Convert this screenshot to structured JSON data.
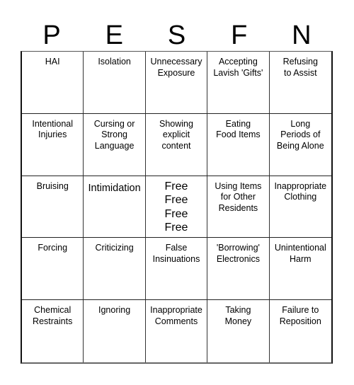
{
  "header": {
    "letters": [
      "P",
      "E",
      "S",
      "F",
      "N"
    ]
  },
  "board": {
    "rows": [
      [
        "HAI",
        "Isolation",
        "Unnecessary\nExposure",
        "Accepting\nLavish 'Gifts'",
        "Refusing\nto Assist"
      ],
      [
        "Intentional\nInjuries",
        "Cursing or\nStrong\nLanguage",
        "Showing\nexplicit\ncontent",
        "Eating\nFood Items",
        "Long\nPeriods of\nBeing Alone"
      ],
      [
        "Bruising",
        "Intimidation",
        "Free\nFree\nFree\nFree",
        "Using Items\nfor Other\nResidents",
        "Inappropriate\nClothing"
      ],
      [
        "Forcing",
        "Criticizing",
        "False\nInsinuations",
        "'Borrowing'\nElectronics",
        "Unintentional\nHarm"
      ],
      [
        "Chemical\nRestraints",
        "Ignoring",
        "Inappropriate\nComments",
        "Taking\nMoney",
        "Failure to\nReposition"
      ]
    ]
  }
}
